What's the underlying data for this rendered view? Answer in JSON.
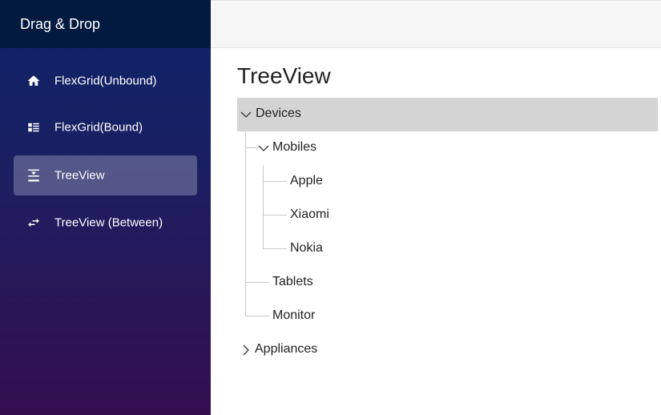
{
  "sidebar": {
    "title": "Drag & Drop",
    "items": [
      {
        "label": "FlexGrid(Unbound)",
        "icon": "home-icon",
        "active": false
      },
      {
        "label": "FlexGrid(Bound)",
        "icon": "list-grid-icon",
        "active": false
      },
      {
        "label": "TreeView",
        "icon": "vertical-align-center-icon",
        "active": true
      },
      {
        "label": "TreeView (Between)",
        "icon": "swap-horiz-icon",
        "active": false
      }
    ]
  },
  "main": {
    "title": "TreeView",
    "tree": {
      "devices": "Devices",
      "mobiles": "Mobiles",
      "apple": "Apple",
      "xiaomi": "Xiaomi",
      "nokia": "Nokia",
      "tablets": "Tablets",
      "monitor": "Monitor",
      "appliances": "Appliances"
    }
  },
  "colors": {
    "sidebar_header": "#031a40",
    "sidebar_top": "#0d2468",
    "sidebar_bottom": "#330e4f",
    "selected_node": "#d4d4d4"
  }
}
